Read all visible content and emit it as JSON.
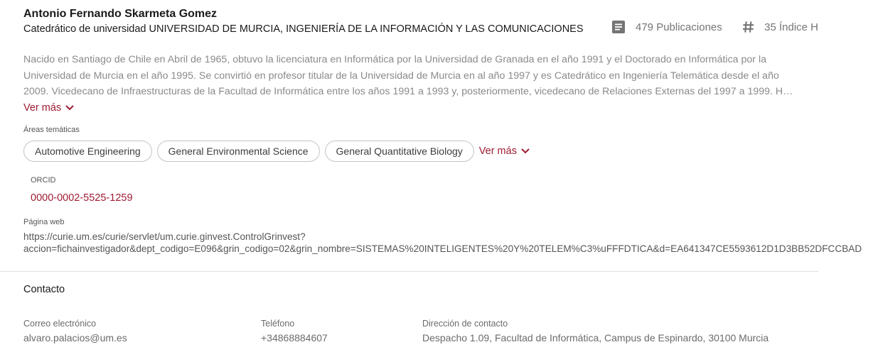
{
  "profile": {
    "name": "Antonio Fernando Skarmeta Gomez",
    "position": "Catedrático de universidad UNIVERSIDAD DE MURCIA, INGENIERÍA DE LA INFORMACIÓN Y LAS COMUNICACIONES"
  },
  "stats": {
    "publications": "479 Publicaciones",
    "publications_icon": "document-icon",
    "h_index": "35 Índice H",
    "h_index_icon": "hash-icon"
  },
  "bio": {
    "lines": [
      "Nacido en Santiago de Chile en Abril de 1965, obtuvo la licenciatura en Informática por la Universidad de Granada en el año 1991 y el Doctorado en Informática por la",
      "Universidad de Murcia en el año 1995. Se convirtió en profesor titular de la Universidad de Murcia en al año 1997 y es Catedrático en Ingeniería Telemática desde el año",
      "2009. Vicedecano de Infraestructuras de la Facultad de Informática entre los años 1991 a 1993 y, posteriormente, vicedecano de Relaciones Externas del 1997 a 1999. H…"
    ],
    "more_label": "Ver más"
  },
  "areas": {
    "label": "Áreas temáticas",
    "items": [
      "Automotive Engineering",
      "General Environmental Science",
      "General Quantitative Biology"
    ],
    "more_label": "Ver más"
  },
  "orcid": {
    "label": "ORCID",
    "value": "0000-0002-5525-1259"
  },
  "website": {
    "label": "Página web",
    "line1": "https://curie.um.es/curie/servlet/um.curie.ginvest.ControlGrinvest?",
    "line2": "accion=fichainvestigador&dept_codigo=E096&grin_codigo=02&grin_nombre=SISTEMAS%20INTELIGENTES%20Y%20TELEM%C3%uFFFDTICA&d=EA641347CE5593612D1D3BB52DFCCBAD"
  },
  "contact": {
    "title": "Contacto",
    "email_label": "Correo electrónico",
    "email": "alvaro.palacios@um.es",
    "phone_label": "Teléfono",
    "phone": "+34868884607",
    "address_label": "Dirección de contacto",
    "address": "Despacho 1.09, Facultad de Informática, Campus de Espinardo, 30100 Murcia"
  },
  "colors": {
    "accent": "#9e1b32",
    "muted_text": "#8a8a8a",
    "chip_border": "#c4c4c4"
  }
}
